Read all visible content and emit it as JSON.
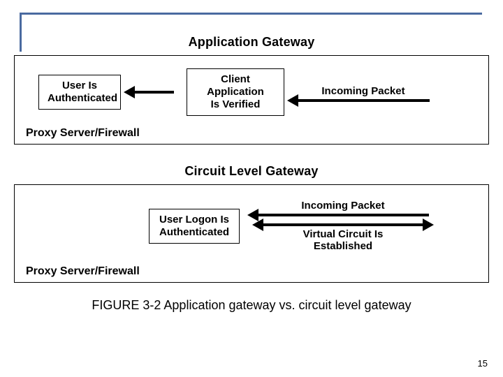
{
  "diagram1": {
    "title": "Application Gateway",
    "node_user": "User Is\nAuthenticated",
    "node_client": "Client Application\nIs Verified",
    "incoming": "Incoming Packet",
    "proxy": "Proxy Server/Firewall"
  },
  "diagram2": {
    "title": "Circuit Level Gateway",
    "node_logon": "User Logon Is\nAuthenticated",
    "incoming": "Incoming Packet",
    "virtual_circuit": "Virtual Circuit Is\nEstablished",
    "proxy": "Proxy Server/Firewall"
  },
  "caption": "FIGURE 3-2 Application gateway vs. circuit level gateway",
  "page": "15"
}
